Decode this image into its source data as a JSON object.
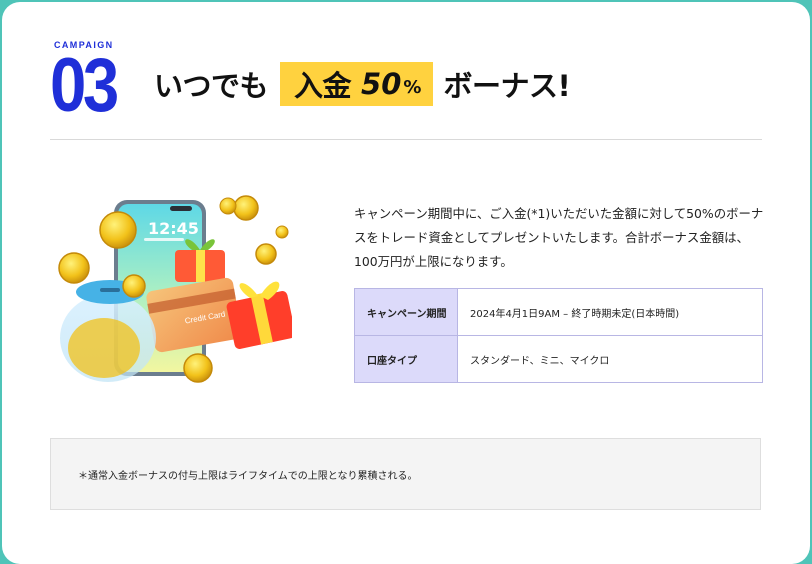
{
  "header": {
    "campaign_label": "CAMPAIGN",
    "campaign_number": "03",
    "title_prefix": "いつでも",
    "title_highlight": "入金",
    "title_highlight_number": "50",
    "title_highlight_unit": "%",
    "title_suffix": "ボーナス!"
  },
  "illustration": {
    "phone_time": "12:45",
    "card_label": "Credit Card"
  },
  "description": "キャンペーン期間中に、ご入金(*1)いただいた金額に対して50%のボーナスをトレード資金としてプレゼントいたします。合計ボーナス金額は、100万円が上限になります。",
  "table": {
    "rows": [
      {
        "label": "キャンペーン期間",
        "value": "2024年4月1日9AM – 終了時期未定(日本時間)"
      },
      {
        "label": "口座タイプ",
        "value": "スタンダード、ミニ、マイクロ"
      }
    ]
  },
  "note": "＊通常入金ボーナスの付与上限はライフタイムでの上限となり累積される。",
  "colors": {
    "accent": "#1f2fd8",
    "highlight": "#ffd23f",
    "table_header": "#dcdafa",
    "background": "#4fc4b8"
  }
}
